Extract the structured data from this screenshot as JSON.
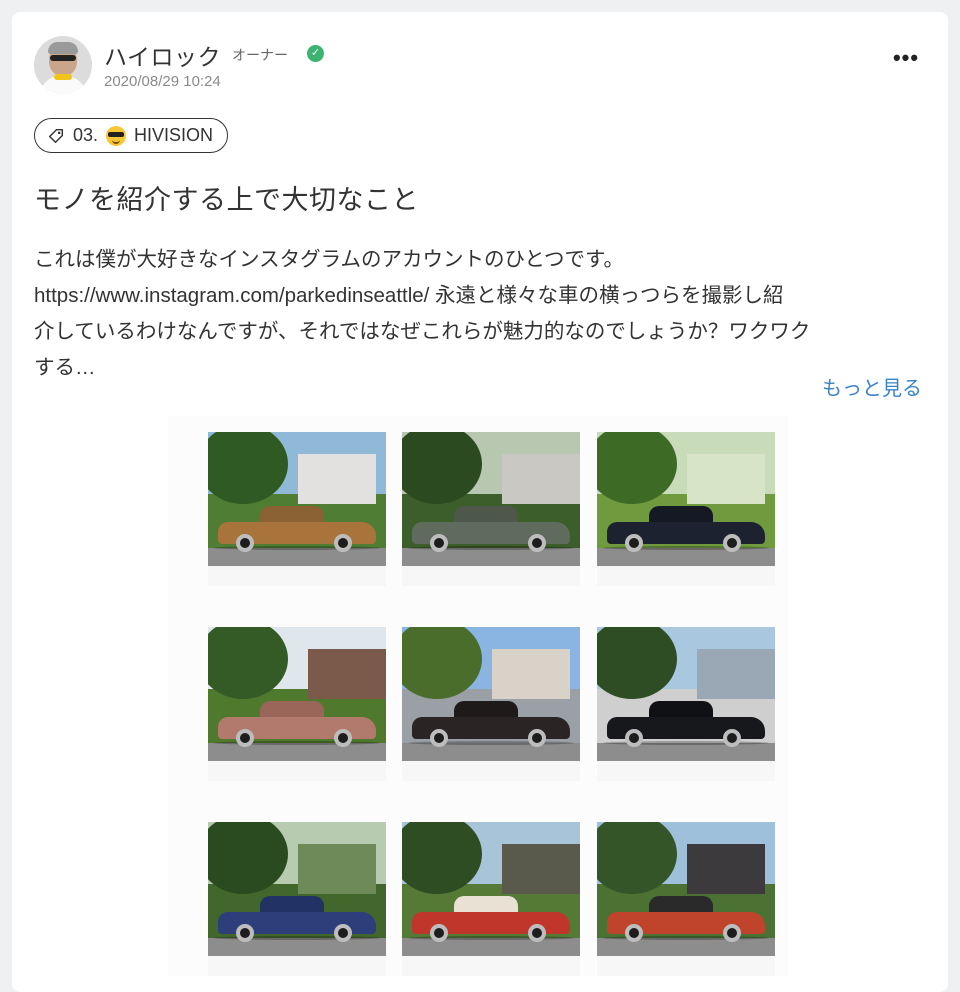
{
  "post": {
    "author": "ハイロック",
    "role": "オーナー",
    "verified_mark": "✓",
    "timestamp": "2020/08/29 10:24",
    "more_label": "•••",
    "tag": {
      "prefix": "03.",
      "name": "HIVISION",
      "icon": "tag-icon",
      "emoji": "smiling-face-with-sunglasses"
    },
    "title": "モノを紹介する上で大切なこと",
    "body_lines": [
      "これは僕が大好きなインスタグラムのアカウントのひとつです。",
      "https://www.instagram.com/parkedinseattle/ 永遠と様々な車の横っつらを撮影し紹",
      "介しているわけなんですが、それではなぜこれらが魅力的なのでしょうか？ワクワク",
      "する…"
    ],
    "read_more": "もっと見る"
  },
  "gallery": {
    "photos": [
      {
        "name": "car-photo-1",
        "sky": "#8fb9d6",
        "lawn": "#4f7d33",
        "house": "#e3e1df",
        "car": "#a8743c",
        "cabin": "#8a6233",
        "tree": "#2f5a23"
      },
      {
        "name": "car-photo-2",
        "sky": "#b8c7b0",
        "lawn": "#3c5e2a",
        "house": "#c9c8c3",
        "car": "#5f6b5c",
        "cabin": "#4d574a",
        "tree": "#2c4a20"
      },
      {
        "name": "car-photo-3",
        "sky": "#c9dcb9",
        "lawn": "#6f9b3e",
        "house": "#d8e4c8",
        "car": "#1c2230",
        "cabin": "#141924",
        "tree": "#3d6a25"
      },
      {
        "name": "car-photo-4",
        "sky": "#dfe6ec",
        "lawn": "#4f7a2d",
        "house": "#7b5a4c",
        "car": "#b27a6c",
        "cabin": "#9a665a",
        "tree": "#345b25"
      },
      {
        "name": "car-photo-5",
        "sky": "#8ab4e2",
        "lawn": "#9aa0a6",
        "house": "#d8d2c8",
        "car": "#2a2424",
        "cabin": "#1e1a1a",
        "tree": "#4a6d2b"
      },
      {
        "name": "car-photo-6",
        "sky": "#a9c7de",
        "lawn": "#cfcfcf",
        "house": "#9aa7b4",
        "car": "#17181c",
        "cabin": "#101114",
        "tree": "#2f4d24"
      },
      {
        "name": "car-photo-7",
        "sky": "#b7cbb0",
        "lawn": "#42672c",
        "house": "#6d8a58",
        "car": "#2d3f7a",
        "cabin": "#233265",
        "tree": "#2a4a1f"
      },
      {
        "name": "car-photo-8",
        "sky": "#a8c4d8",
        "lawn": "#557a35",
        "house": "#5a5a4c",
        "car": "#c0362a",
        "cabin": "#e9e2d4",
        "tree": "#2e4d22"
      },
      {
        "name": "car-photo-9",
        "sky": "#9fc0db",
        "lawn": "#4b7232",
        "house": "#3d3a3d",
        "car": "#c0442c",
        "cabin": "#2a2a2a",
        "tree": "#345527"
      }
    ]
  }
}
